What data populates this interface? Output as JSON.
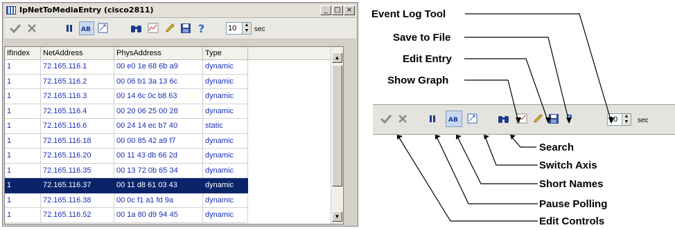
{
  "window": {
    "title": "IpNetToMediaEntry (cisco2811)",
    "buttons": [
      "_",
      "□",
      "×"
    ]
  },
  "toolbar": {
    "interval_value": "10",
    "interval_unit": "sec"
  },
  "table": {
    "columns": [
      "IfIndex",
      "NetAddress",
      "PhysAddress",
      "Type"
    ],
    "rows": [
      [
        "1",
        "72.165.116.1",
        "00 e0 1e 68 6b a9",
        "dynamic"
      ],
      [
        "1",
        "72.165.116.2",
        "00 06 b1 3a 13 6c",
        "dynamic"
      ],
      [
        "1",
        "72.165.116.3",
        "00 14 6c 0c b8 63",
        "dynamic"
      ],
      [
        "1",
        "72.165.116.4",
        "00 20 06 25 00 28",
        "dynamic"
      ],
      [
        "1",
        "72.165.116.6",
        "00 24 14 ec b7 40",
        "static"
      ],
      [
        "1",
        "72.165.116.18",
        "00 00 85 42 a9 f7",
        "dynamic"
      ],
      [
        "1",
        "72.165.116.20",
        "00 11 43 db 66 2d",
        "dynamic"
      ],
      [
        "1",
        "72.165.116.35",
        "00 13 72 0b 65 34",
        "dynamic"
      ],
      [
        "1",
        "72.165.116.37",
        "00 11 d8 61 03 43",
        "dynamic"
      ],
      [
        "1",
        "72.165.116.38",
        "00 0c f1 a1 fd 9a",
        "dynamic"
      ],
      [
        "1",
        "72.165.116.52",
        "00 1a 80 d9 94 45",
        "dynamic"
      ]
    ],
    "selected_row": 8
  },
  "annotations": {
    "event_log_tool": "Event Log Tool",
    "save_to_file": "Save to File",
    "edit_entry": "Edit Entry",
    "show_graph": "Show Graph",
    "search": "Search",
    "switch_axis": "Switch Axis",
    "short_names": "Short Names",
    "pause_polling": "Pause Polling",
    "edit_controls": "Edit Controls"
  },
  "strip": {
    "interval_value": "10",
    "interval_unit": "sec"
  },
  "colors": {
    "cell_text": "#1a2fb5",
    "selection": "#0a246a",
    "toolbar_bg": "#e9e8e2"
  }
}
